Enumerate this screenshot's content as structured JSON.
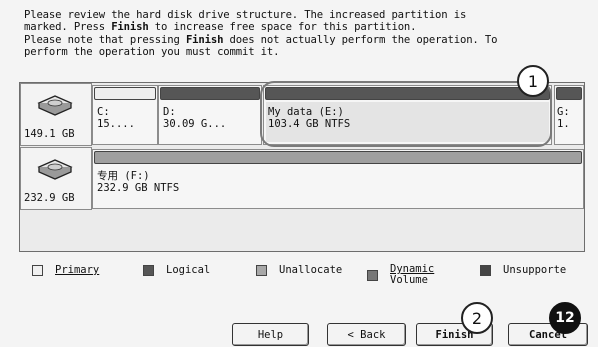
{
  "intro": {
    "line1": "Please review the hard disk drive structure. The increased partition is",
    "line2_a": "marked. Press ",
    "line2_bold": "Finish",
    "line2_b": " to increase free space for this partition.",
    "line3_a": "Please note that pressing ",
    "line3_bold": "Finish",
    "line3_b": " does not actually perform the operation. To",
    "line4": "perform the operation you must commit it."
  },
  "disks": [
    {
      "size": "149.1 GB",
      "partitions": [
        {
          "line1": "C:",
          "line2": "15....",
          "type": "primary"
        },
        {
          "line1": "D:",
          "line2": "30.09 G...",
          "type": "logical"
        },
        {
          "line1": "My data (E:)",
          "line2": "103.4 GB  NTFS",
          "type": "logical",
          "selected": true
        },
        {
          "line1": "G:",
          "line2": "1.",
          "type": "logical"
        }
      ]
    },
    {
      "size": "232.9 GB",
      "partitions": [
        {
          "line1": "专用 (F:)",
          "line2": "232.9 GB  NTFS",
          "type": "unallocated"
        }
      ]
    }
  ],
  "legend": {
    "primary": "Primary",
    "logical": "Logical",
    "unallocated": "Unallocate",
    "dynamic_1": "Dynamic",
    "dynamic_2": "Volume",
    "unsupported": "Unsupporte"
  },
  "buttons": {
    "help": "Help",
    "back": "< Back",
    "finish": "Finish",
    "cancel": "Cancel"
  },
  "annotations": {
    "one": "1",
    "two": "2",
    "three": "12"
  },
  "colors": {
    "logical": "#565656",
    "primary": "#eeeeee",
    "unallocated": "#a8a8a8"
  }
}
